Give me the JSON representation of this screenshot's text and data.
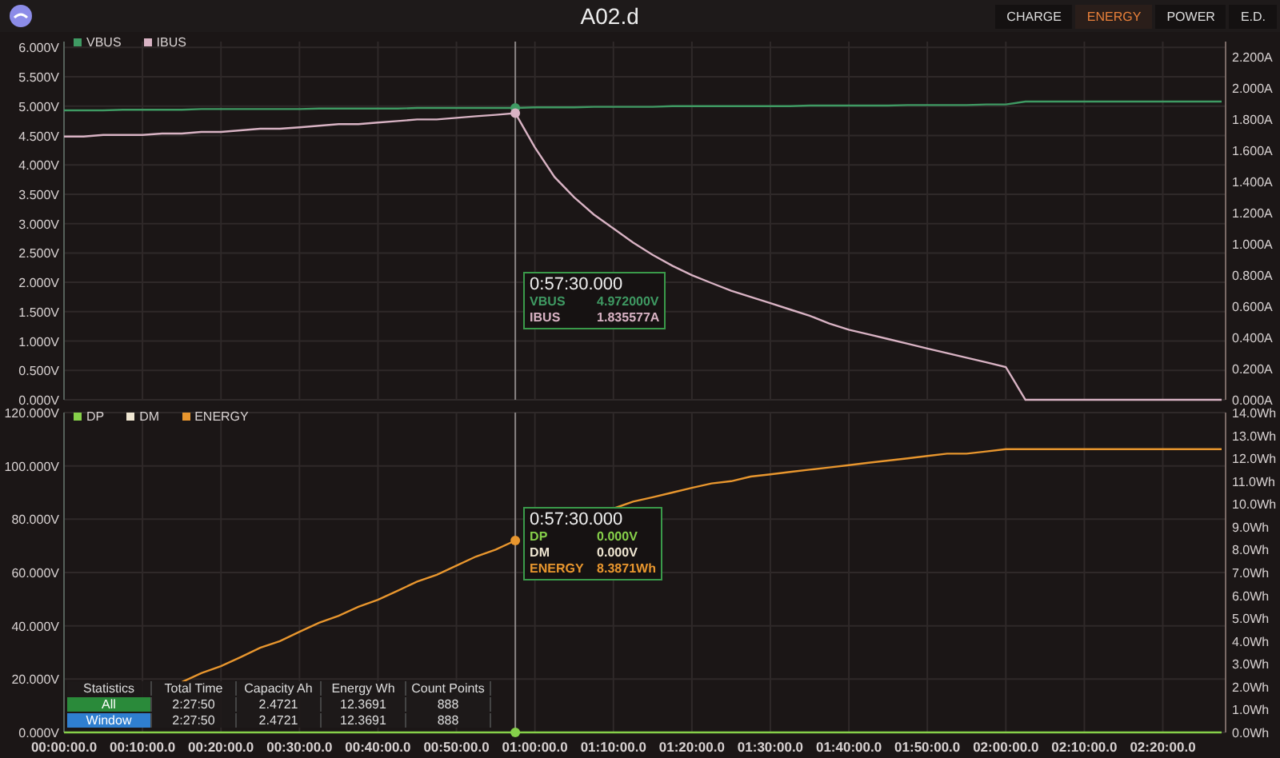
{
  "window": {
    "title": "A02.d"
  },
  "view_buttons": [
    {
      "label": "CHARGE",
      "selected": false
    },
    {
      "label": "ENERGY",
      "selected": true
    },
    {
      "label": "POWER",
      "selected": false
    },
    {
      "label": "E.D.",
      "selected": false
    }
  ],
  "charts": [
    {
      "chart_data": {
        "type": "line",
        "ylim": [
          0,
          6.1
        ],
        "y2lim": [
          0,
          2.3
        ],
        "grid": true,
        "legend": true,
        "categories": [
          null,
          null,
          null,
          null,
          null,
          null,
          null,
          null,
          null,
          null,
          null,
          null,
          null,
          null,
          null,
          null,
          null,
          null,
          null,
          null,
          null,
          null,
          null,
          null,
          null,
          null,
          null,
          null,
          null,
          null,
          null,
          null,
          null,
          null,
          null,
          null,
          null,
          null,
          null,
          null,
          null,
          null,
          null,
          null,
          null,
          null,
          null,
          null,
          null,
          null,
          null,
          null,
          null,
          null,
          null,
          null,
          null,
          null,
          null,
          null
        ],
        "yticks": [
          {
            "value": 0,
            "label": "0.000V"
          },
          {
            "value": 0.5,
            "label": "0.500V"
          },
          {
            "value": 1,
            "label": "1.000V"
          },
          {
            "value": 1.5,
            "label": "1.500V"
          },
          {
            "value": 2,
            "label": "2.000V"
          },
          {
            "value": 2.5,
            "label": "2.500V"
          },
          {
            "value": 3,
            "label": "3.000V"
          },
          {
            "value": 3.5,
            "label": "3.500V"
          },
          {
            "value": 4,
            "label": "4.000V"
          },
          {
            "value": 4.5,
            "label": "4.500V"
          },
          {
            "value": 5,
            "label": "5.000V"
          },
          {
            "value": 5.5,
            "label": "5.500V"
          },
          {
            "value": 6,
            "label": "6.000V"
          }
        ],
        "y2ticks": [
          {
            "value": 0,
            "label": "0.000A"
          },
          {
            "value": 0.2,
            "label": "0.200A"
          },
          {
            "value": 0.4,
            "label": "0.400A"
          },
          {
            "value": 0.6,
            "label": "0.600A"
          },
          {
            "value": 0.8,
            "label": "0.800A"
          },
          {
            "value": 1,
            "label": "1.000A"
          },
          {
            "value": 1.2,
            "label": "1.200A"
          },
          {
            "value": 1.4,
            "label": "1.400A"
          },
          {
            "value": 1.6,
            "label": "1.600A"
          },
          {
            "value": 1.8,
            "label": "1.800A"
          },
          {
            "value": 2,
            "label": "2.000A"
          },
          {
            "value": 2.2,
            "label": "2.200A"
          }
        ],
        "series": [
          {
            "name": "VBUS",
            "color": "#3f9a63",
            "values": [
              4.93,
              4.93,
              4.93,
              4.94,
              4.94,
              4.94,
              4.94,
              4.95,
              4.95,
              4.95,
              4.95,
              4.95,
              4.95,
              4.96,
              4.96,
              4.96,
              4.96,
              4.96,
              4.97,
              4.97,
              4.97,
              4.97,
              4.97,
              4.97,
              4.98,
              4.98,
              4.98,
              4.99,
              4.99,
              4.99,
              4.99,
              5.0,
              5.0,
              5.0,
              5.0,
              5.0,
              5.0,
              5.0,
              5.01,
              5.01,
              5.01,
              5.01,
              5.01,
              5.02,
              5.02,
              5.02,
              5.02,
              5.03,
              5.03,
              5.08,
              5.08,
              5.08,
              5.08,
              5.08,
              5.08,
              5.08,
              5.08,
              5.08,
              5.08,
              5.08
            ]
          },
          {
            "name": "IBUS",
            "color": "#d9b3c4",
            "axis": "y2",
            "values": [
              1.69,
              1.69,
              1.7,
              1.7,
              1.7,
              1.71,
              1.71,
              1.72,
              1.72,
              1.73,
              1.74,
              1.74,
              1.75,
              1.76,
              1.77,
              1.77,
              1.78,
              1.79,
              1.8,
              1.8,
              1.81,
              1.82,
              1.83,
              1.84,
              1.62,
              1.43,
              1.3,
              1.19,
              1.1,
              1.01,
              0.93,
              0.86,
              0.8,
              0.75,
              0.7,
              0.66,
              0.62,
              0.58,
              0.54,
              0.49,
              0.45,
              0.42,
              0.39,
              0.36,
              0.33,
              0.3,
              0.27,
              0.24,
              0.21,
              0,
              0,
              0,
              0,
              0,
              0,
              0,
              0,
              0,
              0,
              0
            ]
          }
        ],
        "annotations": [
          "0:57:30.000"
        ]
      },
      "readout": [
        {
          "name": "VBUS",
          "value": "4.972000V"
        },
        {
          "name": "IBUS",
          "value": "1.835577A"
        }
      ]
    },
    {
      "chart_data": {
        "type": "line",
        "ylim": [
          0,
          120
        ],
        "y2lim": [
          0,
          14
        ],
        "grid": true,
        "legend": true,
        "categories": [
          "00:00:00.0",
          null,
          null,
          null,
          "00:10:00.0",
          null,
          null,
          null,
          "00:20:00.0",
          null,
          null,
          null,
          "00:30:00.0",
          null,
          null,
          null,
          "00:40:00.0",
          null,
          null,
          null,
          "00:50:00.0",
          null,
          null,
          null,
          "01:00:00.0",
          null,
          null,
          null,
          "01:10:00.0",
          null,
          null,
          null,
          "01:20:00.0",
          null,
          null,
          null,
          "01:30:00.0",
          null,
          null,
          null,
          "01:40:00.0",
          null,
          null,
          null,
          "01:50:00.0",
          null,
          null,
          null,
          "02:00:00.0",
          null,
          null,
          null,
          "02:10:00.0",
          null,
          null,
          null,
          "02:20:00.0",
          null,
          null,
          null
        ],
        "yticks": [
          {
            "value": 0,
            "label": "0.000V"
          },
          {
            "value": 20,
            "label": "20.000V"
          },
          {
            "value": 40,
            "label": "40.000V"
          },
          {
            "value": 60,
            "label": "60.000V"
          },
          {
            "value": 80,
            "label": "80.000V"
          },
          {
            "value": 100,
            "label": "100.000V"
          },
          {
            "value": 120,
            "label": "120.000V"
          }
        ],
        "y2ticks": [
          {
            "value": 0,
            "label": "0.0Wh"
          },
          {
            "value": 1,
            "label": "1.0Wh"
          },
          {
            "value": 2,
            "label": "2.0Wh"
          },
          {
            "value": 3,
            "label": "3.0Wh"
          },
          {
            "value": 4,
            "label": "4.0Wh"
          },
          {
            "value": 5,
            "label": "5.0Wh"
          },
          {
            "value": 6,
            "label": "6.0Wh"
          },
          {
            "value": 7,
            "label": "7.0Wh"
          },
          {
            "value": 8,
            "label": "8.0Wh"
          },
          {
            "value": 9,
            "label": "9.0Wh"
          },
          {
            "value": 10,
            "label": "10.0Wh"
          },
          {
            "value": 11,
            "label": "11.0Wh"
          },
          {
            "value": 12,
            "label": "12.0Wh"
          },
          {
            "value": 13,
            "label": "13.0Wh"
          },
          {
            "value": 14,
            "label": "14.0Wh"
          }
        ],
        "series": [
          {
            "name": "DP",
            "color": "#86d04a",
            "values": [
              0,
              0,
              0,
              0,
              0,
              0,
              0,
              0,
              0,
              0,
              0,
              0,
              0,
              0,
              0,
              0,
              0,
              0,
              0,
              0,
              0,
              0,
              0,
              0,
              0,
              0,
              0,
              0,
              0,
              0,
              0,
              0,
              0,
              0,
              0,
              0,
              0,
              0,
              0,
              0,
              0,
              0,
              0,
              0,
              0,
              0,
              0,
              0,
              0,
              0,
              0,
              0,
              0,
              0,
              0,
              0,
              0,
              0,
              0,
              0
            ]
          },
          {
            "name": "DM",
            "color": "#efe6d2",
            "values": [
              null,
              null,
              null,
              null,
              null,
              null,
              null,
              null,
              null,
              null,
              null,
              null,
              null,
              null,
              null,
              null,
              null,
              null,
              null,
              null,
              null,
              null,
              null,
              null,
              null,
              null,
              null,
              null,
              null,
              null,
              null,
              null,
              null,
              null,
              null,
              null,
              null,
              null,
              null,
              null,
              null,
              null,
              null,
              null,
              null,
              null,
              null,
              null,
              null,
              null,
              null,
              null,
              null,
              null,
              null,
              null,
              null,
              null,
              null,
              null
            ]
          },
          {
            "name": "ENERGY",
            "color": "#e8962e",
            "axis": "y2",
            "values": [
              null,
              null,
              null,
              null,
              null,
              null,
              2.2,
              2.6,
              2.9,
              3.3,
              3.7,
              4.0,
              4.4,
              4.8,
              5.1,
              5.5,
              5.8,
              6.2,
              6.6,
              6.9,
              7.3,
              7.7,
              8.0,
              8.4,
              null,
              null,
              null,
              null,
              9.8,
              10.1,
              10.3,
              10.5,
              10.7,
              10.9,
              11.0,
              11.2,
              11.3,
              11.4,
              11.5,
              11.6,
              11.7,
              11.8,
              11.9,
              12.0,
              12.1,
              12.2,
              12.2,
              12.3,
              12.4,
              12.4,
              12.4,
              12.4,
              12.4,
              12.4,
              12.4,
              12.4,
              12.4,
              12.4,
              12.4,
              12.4
            ]
          }
        ],
        "annotations": [
          "0:57:30.000"
        ]
      },
      "readout": [
        {
          "name": "DP",
          "value": "0.000V"
        },
        {
          "name": "DM",
          "value": "0.000V"
        },
        {
          "name": "ENERGY",
          "value": "8.3871Wh"
        }
      ]
    }
  ],
  "statistics": {
    "columns": [
      "Statistics",
      "Total Time",
      "Capacity Ah",
      "Energy Wh",
      "Count Points"
    ],
    "rows": [
      {
        "color": "#2a8a3a",
        "cells": [
          "All",
          "2:27:50",
          "2.4721",
          "12.3691",
          "888"
        ]
      },
      {
        "color": "#2f7fd0",
        "cells": [
          "Window",
          "2:27:50",
          "2.4721",
          "12.3691",
          "888"
        ]
      }
    ]
  }
}
